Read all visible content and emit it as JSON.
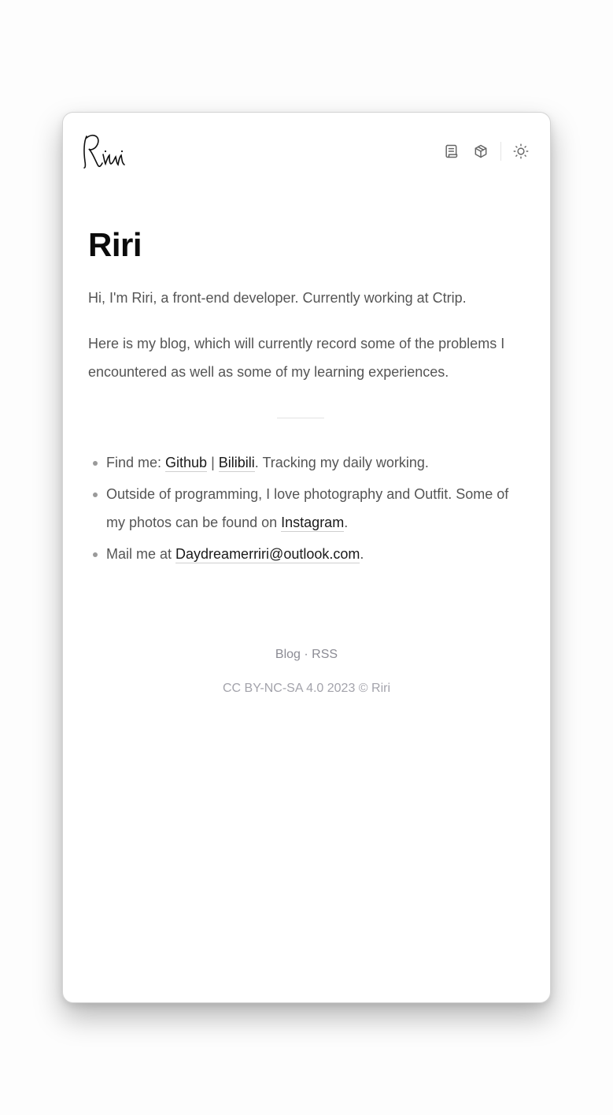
{
  "header": {
    "logo_text": "Riri",
    "nav": [
      {
        "icon": "scroll-icon"
      },
      {
        "icon": "cube-icon"
      },
      {
        "icon": "sun-icon"
      }
    ]
  },
  "main": {
    "title": "Riri",
    "intro": "Hi, I'm Riri, a front-end developer. Currently working at Ctrip.",
    "blog_text": "Here is my blog, which will currently record some of the problems I encountered as well as some of my learning experiences.",
    "list": {
      "find_prefix": "Find me: ",
      "github": "Github",
      "pipe": "|",
      "bilibili": "Bilibili",
      "find_suffix": ". Tracking my daily working.",
      "photo_prefix": "Outside of programming, I love photography and Outfit. Some of my photos can be found on ",
      "instagram": "Instagram",
      "photo_suffix": ".",
      "mail_prefix": "Mail me at ",
      "email": "Daydreamerriri@outlook.com",
      "mail_suffix": "."
    }
  },
  "footer": {
    "blog": "Blog",
    "dot": " · ",
    "rss": "RSS",
    "license": "CC BY-NC-SA 4.0 2023 © Riri"
  },
  "colors": {
    "text": "#555555",
    "heading": "#0b0b0b",
    "muted": "#8b8b94"
  }
}
